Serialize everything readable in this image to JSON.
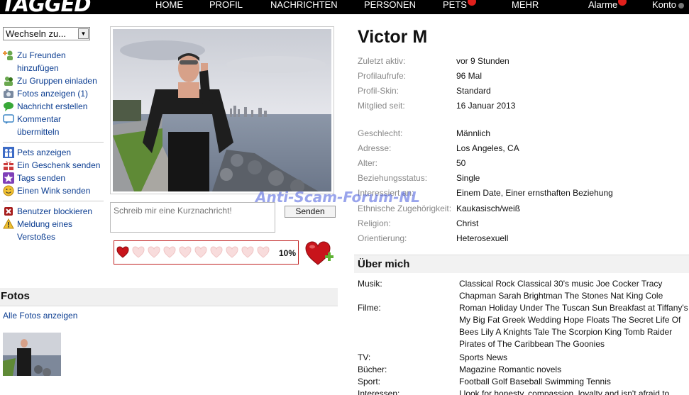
{
  "brand": {
    "logo_text": "TAGGED"
  },
  "nav": {
    "items": [
      "HOME",
      "PROFIL",
      "NACHRICHTEN",
      "PERSONEN",
      "PETS",
      "MEHR"
    ],
    "alarms": "Alarme",
    "account": "Konto"
  },
  "sidebar": {
    "switch_label": "Wechseln zu...",
    "actions": [
      {
        "label": "Zu Freunden hinzufügen",
        "icon": "add-friend-icon"
      },
      {
        "label": "Zu Gruppen einladen",
        "icon": "invite-group-icon"
      },
      {
        "label": "Fotos anzeigen (1)",
        "icon": "camera-icon"
      },
      {
        "label": "Nachricht erstellen",
        "icon": "speech-bubble-icon"
      },
      {
        "label": "Kommentar übermitteln",
        "icon": "comment-icon"
      },
      {
        "label": "Pets anzeigen",
        "icon": "pets-icon"
      },
      {
        "label": "Ein Geschenk senden",
        "icon": "gift-icon"
      },
      {
        "label": "Tags senden",
        "icon": "star-icon"
      },
      {
        "label": "Einen Wink senden",
        "icon": "smiley-icon"
      },
      {
        "label": "Benutzer blockieren",
        "icon": "block-icon"
      },
      {
        "label": "Meldung eines Verstoßes",
        "icon": "warning-icon"
      }
    ]
  },
  "message": {
    "placeholder": "Schreib mir eine Kurznachricht!",
    "send_label": "Senden"
  },
  "meter": {
    "percent_label": "10%",
    "value": 0.1
  },
  "fotos": {
    "header": "Fotos",
    "all_link": "Alle Fotos anzeigen"
  },
  "watermark": "Anti-Scam-Forum-NL",
  "profile": {
    "name": "Victor M",
    "stats": [
      {
        "label": "Zuletzt aktiv:",
        "value": "vor 9 Stunden"
      },
      {
        "label": "Profilaufrufe:",
        "value": "96 Mal"
      },
      {
        "label": "Profil-Skin:",
        "value": "Standard"
      },
      {
        "label": "Mitglied seit:",
        "value": "16 Januar 2013"
      }
    ],
    "details": [
      {
        "label": "Geschlecht:",
        "value": "Männlich"
      },
      {
        "label": "Adresse:",
        "value": "Los Angeles, CA"
      },
      {
        "label": "Alter:",
        "value": "50"
      },
      {
        "label": "Beziehungsstatus:",
        "value": "Single"
      },
      {
        "label": "Interessiert an:",
        "value": "Einem Date, Einer ernsthaften Beziehung"
      },
      {
        "label": "Ethnische Zugehörigkeit:",
        "value": "Kaukasisch/weiß"
      },
      {
        "label": "Religion:",
        "value": "Christ"
      },
      {
        "label": "Orientierung:",
        "value": "Heterosexuell"
      }
    ]
  },
  "about": {
    "header": "Über mich",
    "rows": [
      {
        "label": "Musik:",
        "value": "Classical Rock Classical 30's music Joe Cocker Tracy Chapman Sarah Brightman The Stones Nat King Cole"
      },
      {
        "label": "Filme:",
        "value": "Roman Holiday Under The Tuscan Sun Breakfast at Tiffany's My Big Fat Greek Wedding Hope Floats The Secret Life Of Bees Lily A Knights Tale The Scorpion King Tomb Raider Pirates of The Caribbean The Goonies"
      },
      {
        "label": "TV:",
        "value": "Sports News"
      },
      {
        "label": "Bücher:",
        "value": "Magazine Romantic novels"
      },
      {
        "label": "Sport:",
        "value": "Football Golf Baseball Swimming Tennis"
      },
      {
        "label": "Interessen:",
        "value": "I look for honesty, compassion, loyalty and isn't afraid to"
      }
    ]
  }
}
